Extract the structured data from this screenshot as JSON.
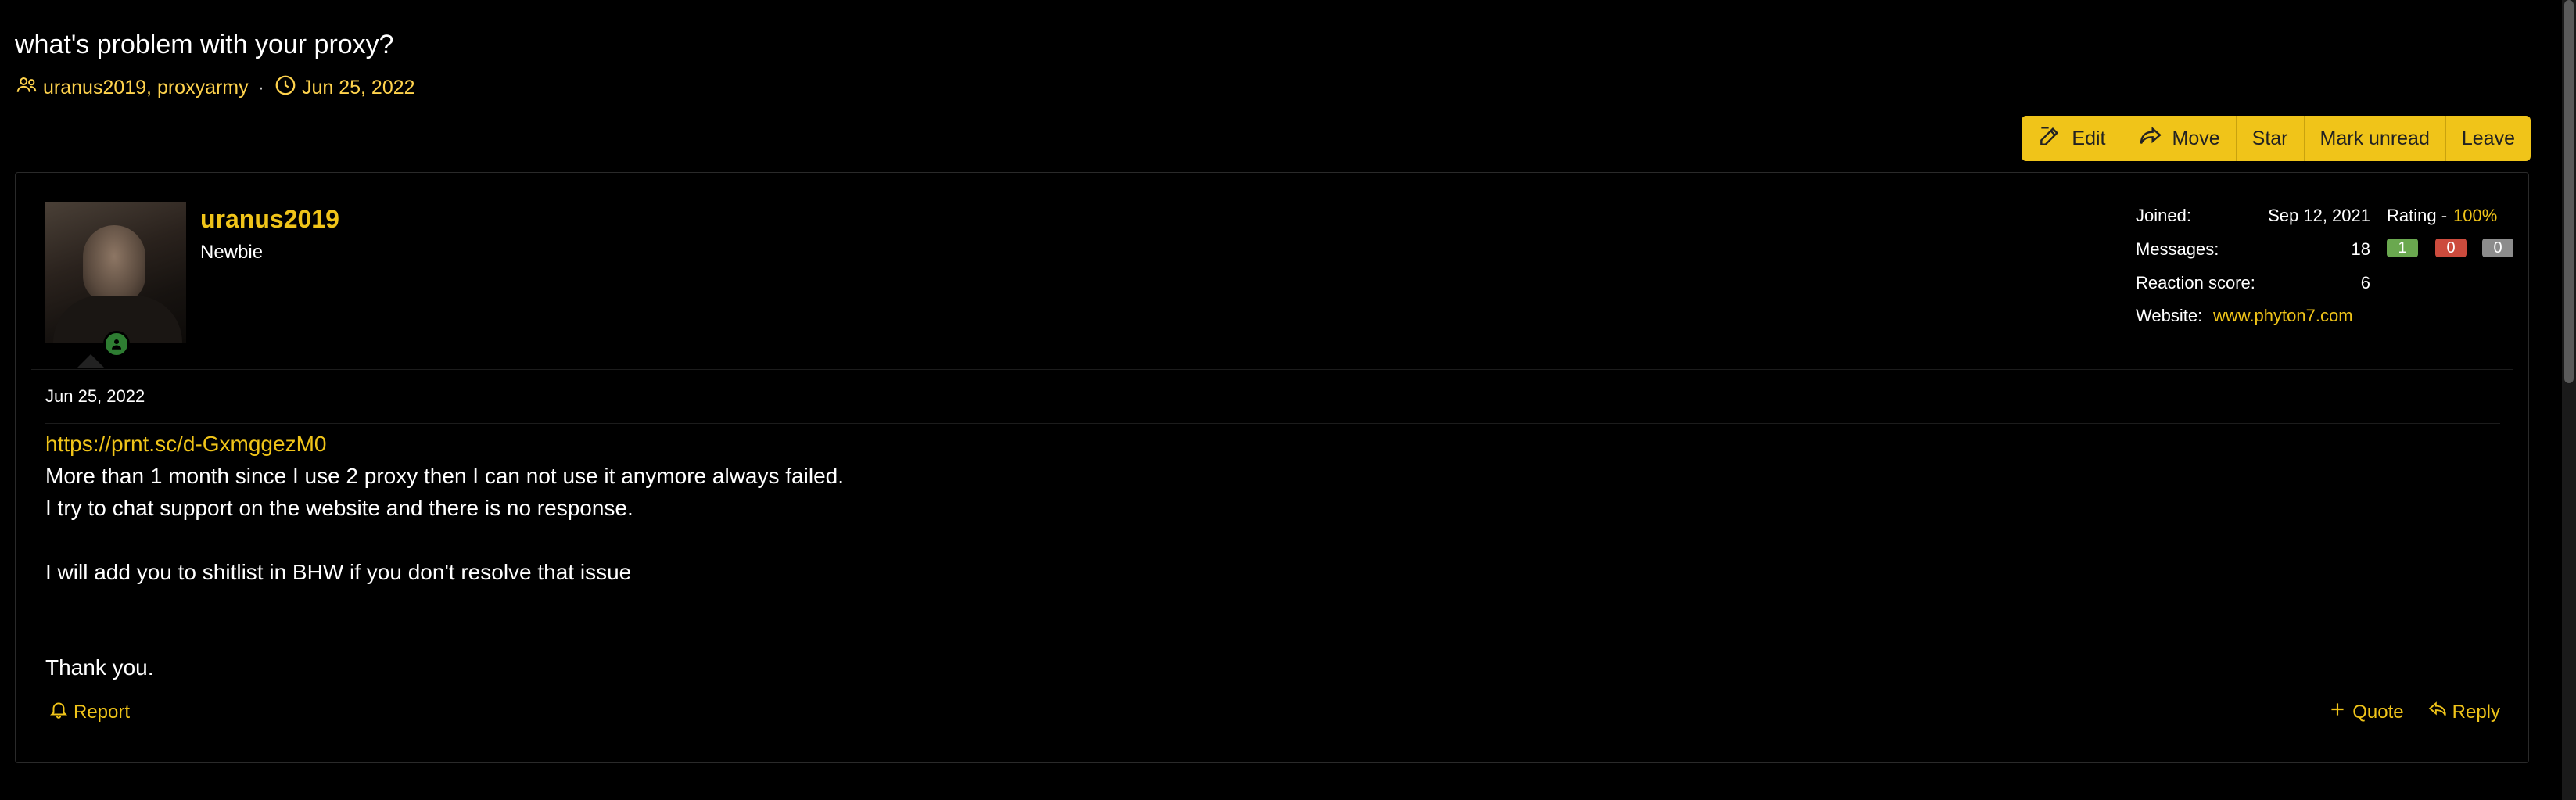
{
  "thread": {
    "title": "what's problem with your proxy?",
    "participants": "uranus2019, proxyarmy",
    "separator": "·",
    "date": "Jun 25, 2022"
  },
  "actions": {
    "edit": "Edit",
    "move": "Move",
    "star": "Star",
    "mark_unread": "Mark unread",
    "leave": "Leave"
  },
  "post": {
    "author": "uranus2019",
    "author_title": "Newbie",
    "date": "Jun 25, 2022",
    "link": "https://prnt.sc/d-GxmggezM0",
    "lines": [
      "More than 1 month since I use 2 proxy then I can not use it anymore always failed.",
      "I try to chat support on the website and there is no response.",
      "I will add you to shitlist in BHW if you don't resolve that issue",
      "Thank you."
    ],
    "report": "Report",
    "quote": "Quote",
    "reply": "Reply"
  },
  "stats": {
    "joined_label": "Joined:",
    "joined": "Sep 12, 2021",
    "rating_label": "Rating -",
    "rating": "100%",
    "messages_label": "Messages:",
    "messages": "18",
    "reaction_label": "Reaction score:",
    "reaction": "6",
    "website_label": "Website:",
    "website": "www.phyton7.com",
    "badges": {
      "positive": "1",
      "negative": "0",
      "neutral": "0"
    }
  },
  "colors": {
    "accent": "#f0c419",
    "positive": "#6aa84f",
    "negative": "#cc4b3d",
    "neutral": "#8c8c8c"
  }
}
